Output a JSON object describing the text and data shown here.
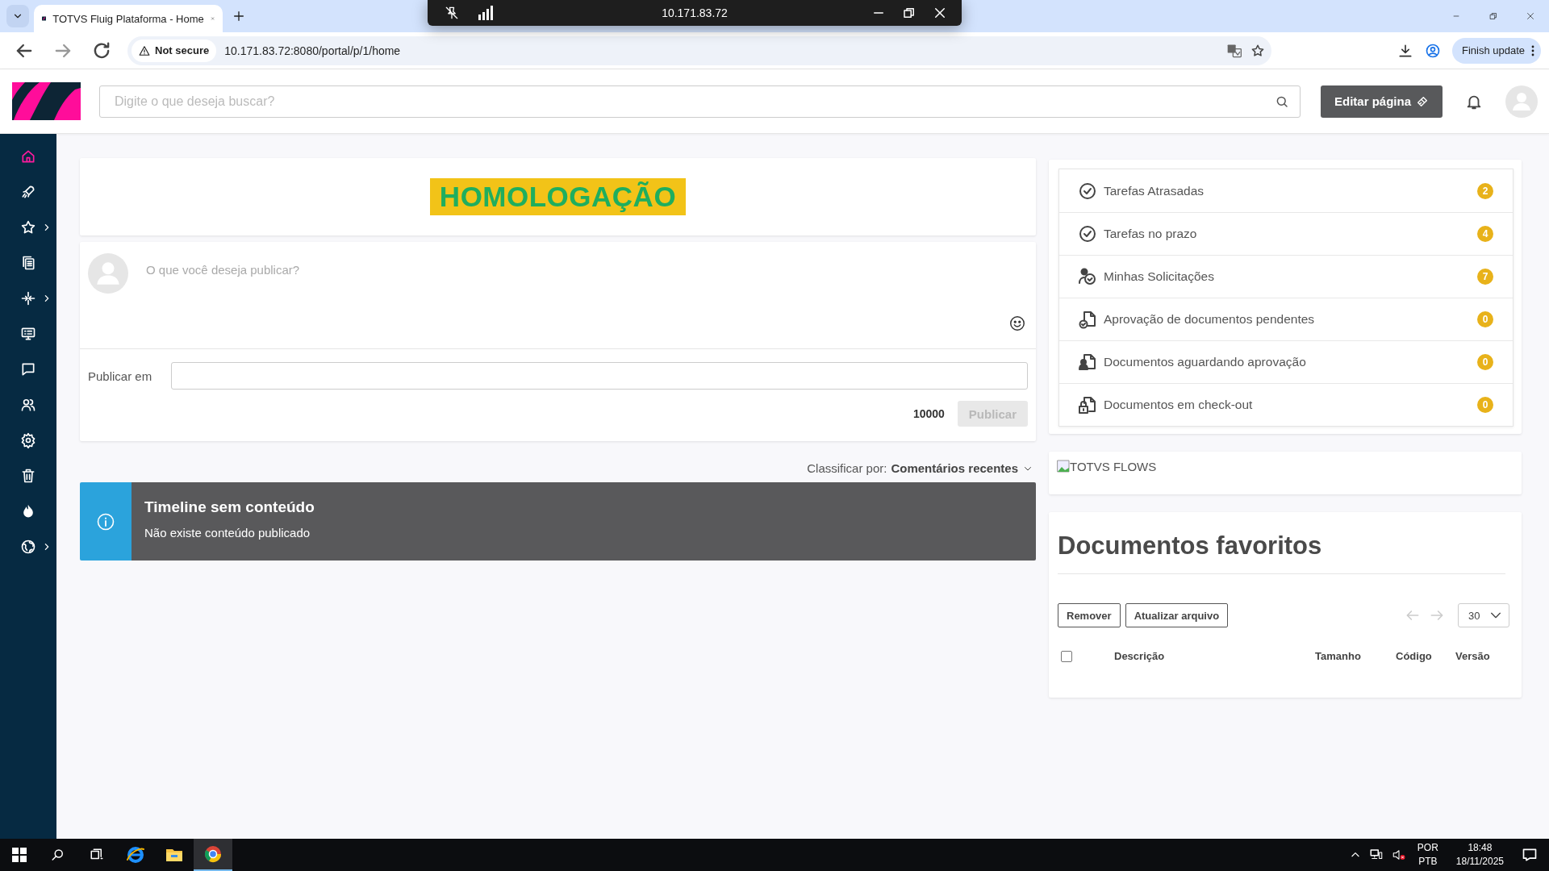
{
  "browser": {
    "tab_title": "TOTVS Fluig Plataforma - Home",
    "security_label": "Not secure",
    "url": "10.171.83.72:8080/portal/p/1/home",
    "update_button": "Finish update"
  },
  "remote_bar": {
    "title": "10.171.83.72"
  },
  "header": {
    "search": {
      "placeholder": "Digite o que deseja buscar?"
    },
    "edit_button": "Editar página"
  },
  "sidebar": {
    "items": [
      {
        "selected": true,
        "submenu": false
      },
      {
        "selected": false,
        "submenu": false
      },
      {
        "selected": false,
        "submenu": true
      },
      {
        "selected": false,
        "submenu": false
      },
      {
        "selected": false,
        "submenu": true
      },
      {
        "selected": false,
        "submenu": false
      },
      {
        "selected": false,
        "submenu": false
      },
      {
        "selected": false,
        "submenu": false
      },
      {
        "selected": false,
        "submenu": false
      },
      {
        "selected": false,
        "submenu": false
      },
      {
        "selected": false,
        "submenu": false
      },
      {
        "selected": false,
        "submenu": true
      }
    ]
  },
  "banner": {
    "text": "HOMOLOGAÇÃO"
  },
  "composer": {
    "placeholder": "O que você deseja publicar?",
    "publish_in_label": "Publicar em",
    "counter": "10000",
    "publish_button": {
      "label": "Publicar",
      "disabled": true
    }
  },
  "sort": {
    "label": "Classificar por:",
    "value": "Comentários recentes"
  },
  "alert": {
    "title": "Timeline sem conteúdo",
    "message": "Não existe conteúdo publicado"
  },
  "tasks": [
    {
      "label": "Tarefas Atrasadas",
      "count": "2"
    },
    {
      "label": "Tarefas no prazo",
      "count": "4"
    },
    {
      "label": "Minhas Solicitações",
      "count": "7"
    },
    {
      "label": "Aprovação de documentos pendentes",
      "count": "0"
    },
    {
      "label": "Documentos aguardando aprovação",
      "count": "0"
    },
    {
      "label": "Documentos em check-out",
      "count": "0"
    }
  ],
  "flows": {
    "alt_text": "TOTVS FLOWS"
  },
  "favorites": {
    "title": "Documentos favoritos",
    "buttons": [
      "Remover",
      "Atualizar arquivo"
    ],
    "page_size": "30",
    "select_all": {
      "checked": false
    },
    "columns": [
      "Descrição",
      "Tamanho",
      "Código",
      "Versão"
    ]
  },
  "taskbar": {
    "apps": [
      {
        "selected": false
      },
      {
        "selected": false
      },
      {
        "selected": true
      }
    ],
    "language": "POR",
    "layout": "PTB",
    "time": "18:48",
    "date": "18/11/2025"
  }
}
